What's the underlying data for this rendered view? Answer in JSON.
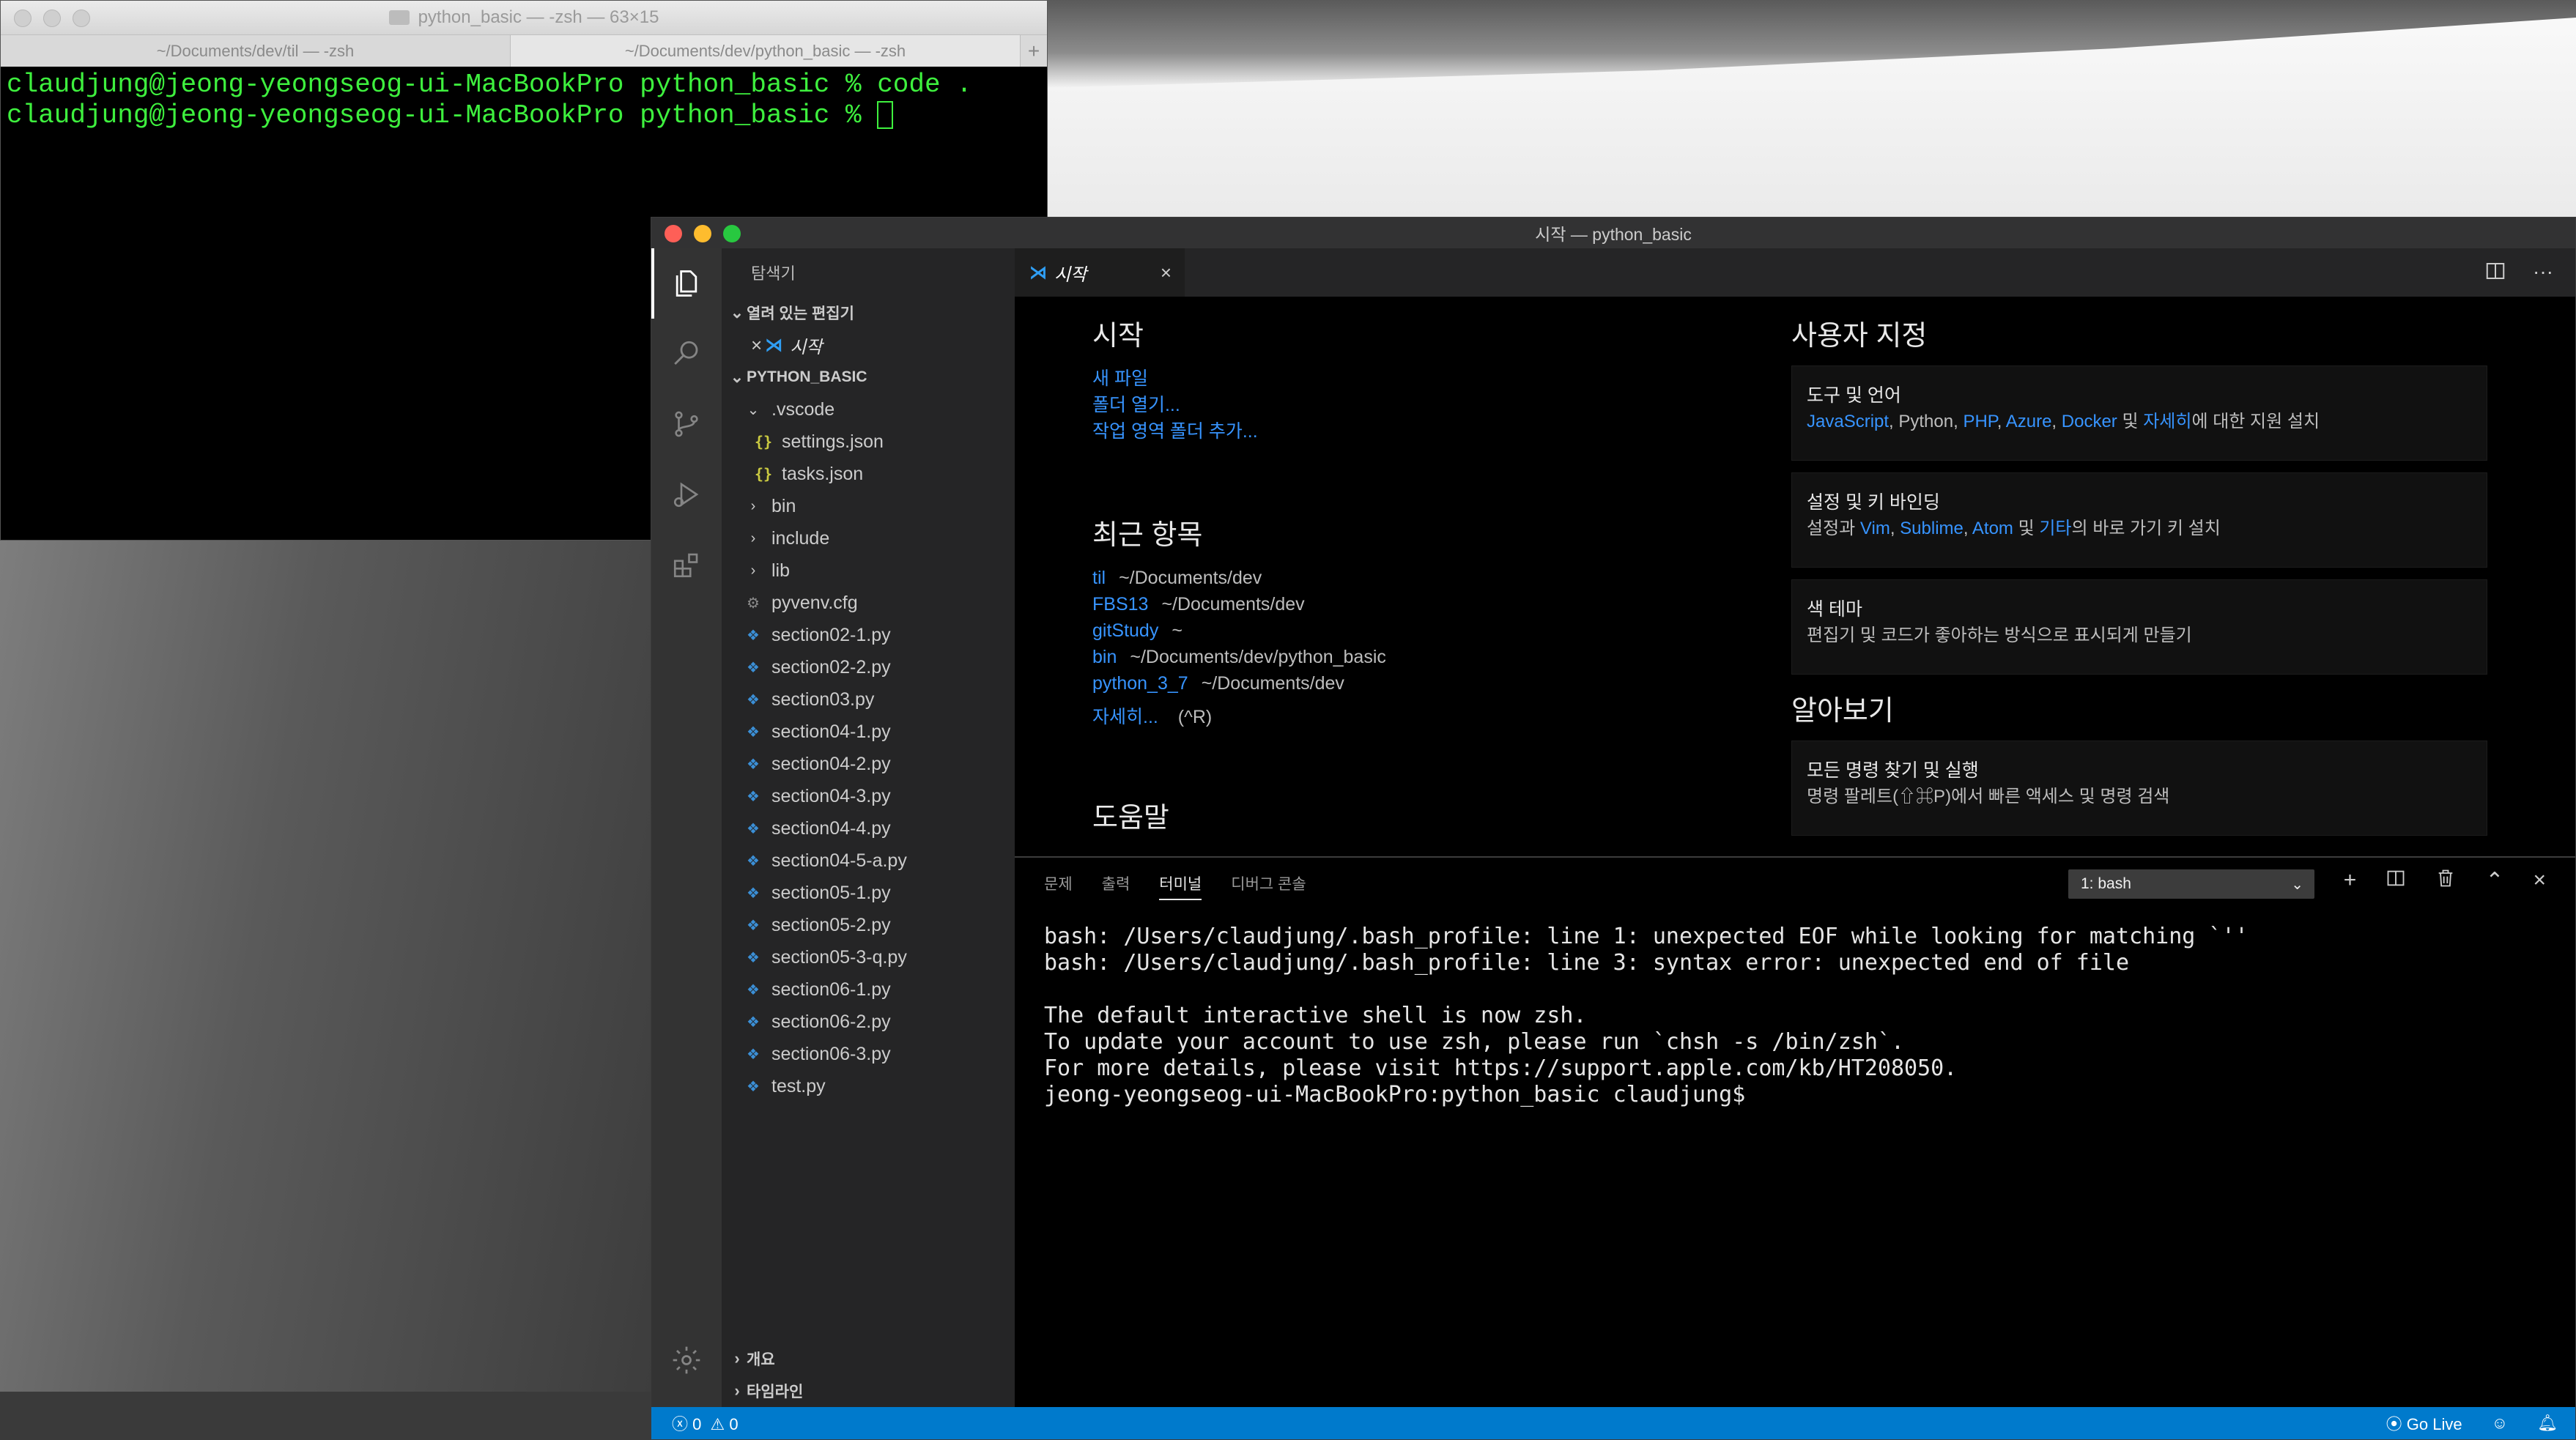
{
  "terminal_window": {
    "title": "python_basic — -zsh — 63×15",
    "tabs": [
      "~/Documents/dev/til — -zsh",
      "~/Documents/dev/python_basic — -zsh"
    ],
    "lines": [
      "claudjung@jeong-yeongseog-ui-MacBookPro python_basic % code .",
      "claudjung@jeong-yeongseog-ui-MacBookPro python_basic % "
    ]
  },
  "vscode": {
    "title": "시작 — python_basic",
    "sidebar": {
      "title": "탐색기",
      "open_editors_label": "열려 있는 편집기",
      "open_editor_item": "시작",
      "folder_label": "PYTHON_BASIC",
      "tree": [
        {
          "name": ".vscode",
          "kind": "folder-open"
        },
        {
          "name": "settings.json",
          "kind": "json"
        },
        {
          "name": "tasks.json",
          "kind": "json"
        },
        {
          "name": "bin",
          "kind": "folder"
        },
        {
          "name": "include",
          "kind": "folder"
        },
        {
          "name": "lib",
          "kind": "folder"
        },
        {
          "name": "pyvenv.cfg",
          "kind": "cfg"
        },
        {
          "name": "section02-1.py",
          "kind": "py"
        },
        {
          "name": "section02-2.py",
          "kind": "py"
        },
        {
          "name": "section03.py",
          "kind": "py"
        },
        {
          "name": "section04-1.py",
          "kind": "py"
        },
        {
          "name": "section04-2.py",
          "kind": "py"
        },
        {
          "name": "section04-3.py",
          "kind": "py"
        },
        {
          "name": "section04-4.py",
          "kind": "py"
        },
        {
          "name": "section04-5-a.py",
          "kind": "py"
        },
        {
          "name": "section05-1.py",
          "kind": "py"
        },
        {
          "name": "section05-2.py",
          "kind": "py"
        },
        {
          "name": "section05-3-q.py",
          "kind": "py"
        },
        {
          "name": "section06-1.py",
          "kind": "py"
        },
        {
          "name": "section06-2.py",
          "kind": "py"
        },
        {
          "name": "section06-3.py",
          "kind": "py"
        },
        {
          "name": "test.py",
          "kind": "py"
        }
      ],
      "outline_label": "개요",
      "timeline_label": "타임라인"
    },
    "tab": {
      "label": "시작"
    },
    "welcome": {
      "start_heading": "시작",
      "start_links": [
        "새 파일",
        "폴더 열기...",
        "작업 영역 폴더 추가..."
      ],
      "recent_heading": "최근 항목",
      "recent": [
        {
          "name": "til",
          "path": "~/Documents/dev"
        },
        {
          "name": "FBS13",
          "path": "~/Documents/dev"
        },
        {
          "name": "gitStudy",
          "path": "~"
        },
        {
          "name": "bin",
          "path": "~/Documents/dev/python_basic"
        },
        {
          "name": "python_3_7",
          "path": "~/Documents/dev"
        }
      ],
      "more_label": "자세히...",
      "more_shortcut": "(^R)",
      "help_heading": "도움말",
      "customize_heading": "사용자 지정",
      "cards": {
        "tools": {
          "title": "도구 및 언어",
          "items": [
            "JavaScript",
            ", Python, ",
            "PHP",
            ", ",
            "Azure",
            ", ",
            "Docker",
            " 및 ",
            "자세히",
            "에 대한 지원 설치"
          ]
        },
        "keys": {
          "title": "설정 및 키 바인딩",
          "items": [
            "설정과 ",
            "Vim",
            ", ",
            "Sublime",
            ", ",
            "Atom",
            " 및 ",
            "기타",
            "의 바로 가기 키 설치"
          ]
        },
        "theme": {
          "title": "색 테마",
          "desc": "편집기 및 코드가 좋아하는 방식으로 표시되게 만들기"
        }
      },
      "learn_heading": "알아보기",
      "learn_card": {
        "title": "모든 명령 찾기 및 실행",
        "desc": "명령 팔레트(⇧⌘P)에서 빠른 액세스 및 명령 검색"
      }
    },
    "panel": {
      "tabs": [
        "문제",
        "출력",
        "터미널",
        "디버그 콘솔"
      ],
      "active_tab": "터미널",
      "terminal_select": "1: bash",
      "output_lines": [
        "bash: /Users/claudjung/.bash_profile: line 1: unexpected EOF while looking for matching `''",
        "bash: /Users/claudjung/.bash_profile: line 3: syntax error: unexpected end of file",
        "",
        "The default interactive shell is now zsh.",
        "To update your account to use zsh, please run `chsh -s /bin/zsh`.",
        "For more details, please visit https://support.apple.com/kb/HT208050.",
        "jeong-yeongseog-ui-MacBookPro:python_basic claudjung$ "
      ]
    },
    "statusbar": {
      "errors": "0",
      "warnings": "0",
      "go_live": "Go Live"
    }
  },
  "colors": {
    "accent_blue": "#007acc",
    "link_blue": "#3794ff",
    "terminal_green": "#3ef03e"
  }
}
